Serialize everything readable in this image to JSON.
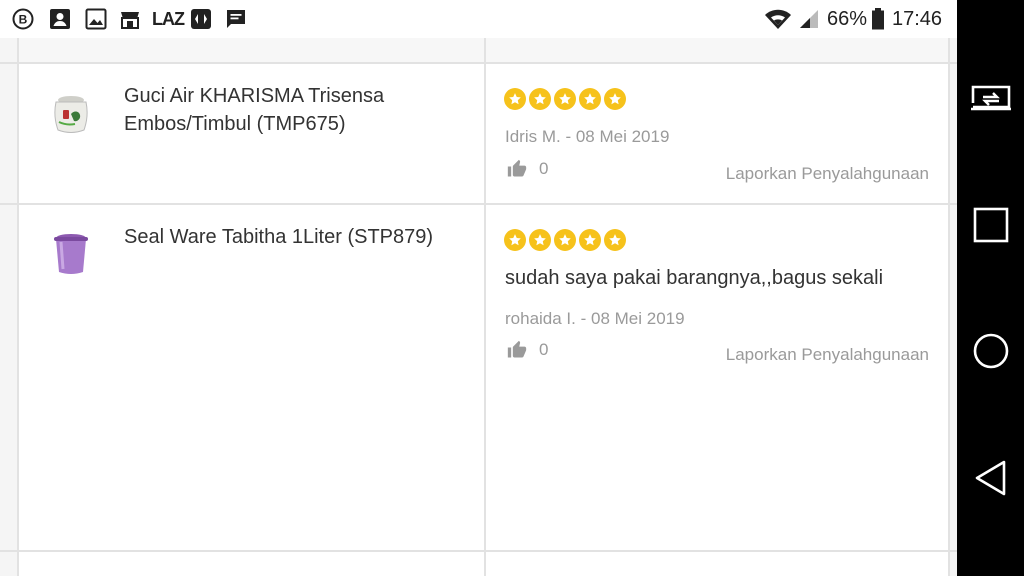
{
  "status_bar": {
    "battery": "66%",
    "time": "17:46",
    "notification_icons": [
      "b-icon",
      "contact-icon",
      "image-icon",
      "shop-icon",
      "laz-icon",
      "app-icon",
      "message-icon"
    ],
    "laz_text": "LAZ"
  },
  "reviews": [
    {
      "product": "Guci Air KHARISMA Trisensa Embos/Timbul (TMP675)",
      "rating": 5,
      "comment": "",
      "reviewer": "Idris M. - 08 Mei 2019",
      "likes": "0",
      "report_label": "Laporkan Penyalahgunaan"
    },
    {
      "product": "Seal Ware Tabitha 1Liter (STP879)",
      "rating": 5,
      "comment": "sudah saya pakai barangnya,,bagus sekali",
      "reviewer": "rohaida I. - 08 Mei 2019",
      "likes": "0",
      "report_label": "Laporkan Penyalahgunaan"
    }
  ],
  "nav_bar": {
    "buttons": [
      "screen-share-icon",
      "recents-icon",
      "home-icon",
      "back-icon"
    ]
  },
  "colors": {
    "star": "#f6c21b",
    "muted_text": "#9a9a9a",
    "text": "#333333",
    "divider": "#e2e2e2",
    "nav_bg": "#000000"
  }
}
